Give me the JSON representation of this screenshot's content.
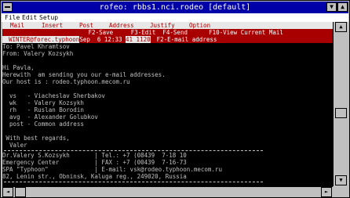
{
  "window": {
    "title": "rofeo: rbbs1.nci.rodeo [default]",
    "minimize_glyph": "▼",
    "maximize_glyph": "▲"
  },
  "menubar": {
    "items": [
      "File",
      "Edit",
      "Setup"
    ]
  },
  "mail_menu": {
    "items": [
      "Mail",
      "Insert",
      "Post",
      "Address",
      "Justify",
      "Option"
    ]
  },
  "mail_header": {
    "fkeys_line": "   F2-Save     F3-Edit  F4-Send      F10-View Current Mail",
    "to_cell": "WINTER@forec.typhoon",
    "date_field": "Sep  6 12:33 ",
    "size_field": "41 1120",
    "hint": "F2-E-mail address"
  },
  "body_lines": [
    "To: Pavel Khramtsov",
    "From: Valery Kozsykh",
    "",
    "Hi Pavla,",
    "Herewith  am sending you our e-mail addresses.",
    "Our host is : rodeo.typhoon.mecom.ru",
    "",
    "  vs   - Viacheslav Sherbakov",
    "  wk   - Valery Kozsykh",
    "  rh   - Ruslan Borodin",
    "  avg  - Alexander Golubkov",
    "  post - Common address",
    "",
    " With best regards,",
    "  Valer"
  ],
  "signature_lines": [
    "Dr.Valery S.Kozsykh       | Tel.: +7 (08439  7-18 10",
    "Emergency Center          | FAX : +7 (00439  7-16-73",
    "SPA \"Typhoon\"             | E-mail: vsk@rodeo.typhoon.mecom.ru",
    "82, Lenin str., Obninsk, Kaluga reg., 249020, Russia"
  ],
  "scroll": {
    "up": "▲",
    "down": "▼",
    "left": "◄",
    "right": "►"
  }
}
